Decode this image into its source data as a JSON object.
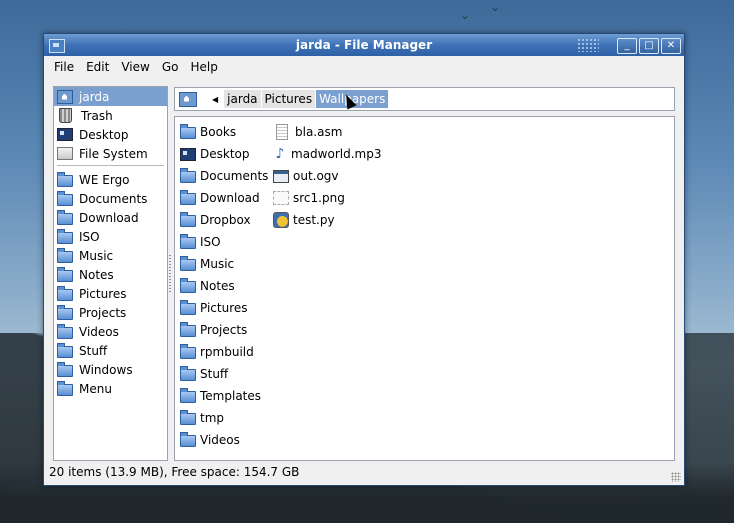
{
  "window": {
    "title": "jarda - File Manager",
    "minimize": "_",
    "maximize": "□",
    "close": "✕"
  },
  "menu": [
    "File",
    "Edit",
    "View",
    "Go",
    "Help"
  ],
  "sidebar": {
    "places": [
      {
        "label": "jarda",
        "icon": "home-icon",
        "selected": true
      },
      {
        "label": "Trash",
        "icon": "trash-icon"
      },
      {
        "label": "Desktop",
        "icon": "desktop-icon"
      },
      {
        "label": "File System",
        "icon": "filesystem-icon"
      }
    ],
    "bookmarks": [
      "WE Ergo",
      "Documents",
      "Download",
      "ISO",
      "Music",
      "Notes",
      "Pictures",
      "Projects",
      "Videos",
      "Stuff",
      "Windows",
      "Menu"
    ]
  },
  "pathbar": {
    "crumbs": [
      "jarda",
      "Pictures",
      "Wallpapers"
    ],
    "active_index": 2
  },
  "files": {
    "column1": [
      {
        "name": "Books",
        "icon": "folder-icon"
      },
      {
        "name": "Desktop",
        "icon": "desktop-icon"
      },
      {
        "name": "Documents",
        "icon": "folder-icon"
      },
      {
        "name": "Download",
        "icon": "folder-icon"
      },
      {
        "name": "Dropbox",
        "icon": "folder-icon"
      },
      {
        "name": "ISO",
        "icon": "folder-icon"
      },
      {
        "name": "Music",
        "icon": "folder-icon"
      },
      {
        "name": "Notes",
        "icon": "folder-icon"
      },
      {
        "name": "Pictures",
        "icon": "folder-icon"
      },
      {
        "name": "Projects",
        "icon": "folder-icon"
      },
      {
        "name": "rpmbuild",
        "icon": "folder-icon"
      },
      {
        "name": "Stuff",
        "icon": "folder-icon"
      },
      {
        "name": "Templates",
        "icon": "folder-icon"
      },
      {
        "name": "tmp",
        "icon": "folder-icon"
      },
      {
        "name": "Videos",
        "icon": "folder-icon"
      }
    ],
    "column2": [
      {
        "name": "bla.asm",
        "icon": "text-file-icon"
      },
      {
        "name": "madworld.mp3",
        "icon": "audio-file-icon"
      },
      {
        "name": "out.ogv",
        "icon": "video-file-icon"
      },
      {
        "name": "src1.png",
        "icon": "image-file-icon"
      },
      {
        "name": "test.py",
        "icon": "python-file-icon"
      }
    ]
  },
  "status": "20 items (13.9 MB), Free space: 154.7 GB",
  "colors": {
    "titlebar": "#3f72b6",
    "selection": "#7b9fcf",
    "folder": "#5b8fd4"
  }
}
